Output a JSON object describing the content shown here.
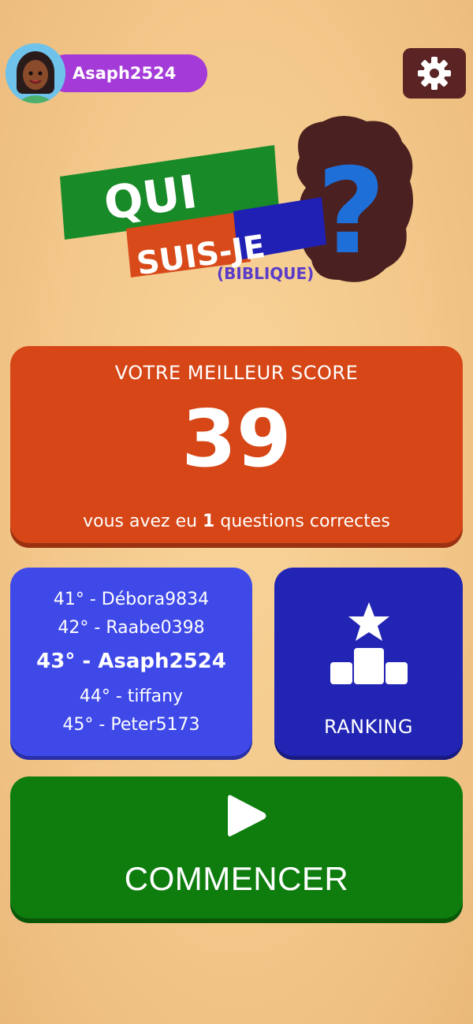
{
  "header": {
    "username": "Asaph2524",
    "settings_icon": "gear-icon",
    "avatar_icon": "avatar-icon"
  },
  "logo": {
    "line1": "QUI",
    "line2": "SUIS-JE",
    "line3": "(BIBLIQUE)",
    "mark": "?"
  },
  "score_card": {
    "label": "VOTRE MEILLEUR SCORE",
    "value": "39",
    "sub_prefix": "vous avez eu ",
    "sub_count": "1",
    "sub_suffix": " questions correctes"
  },
  "leaderboard": {
    "rows": [
      {
        "text": "41° - Débora9834"
      },
      {
        "text": "42° - Raabe0398"
      },
      {
        "text": "43° - Asaph2524",
        "current": true
      },
      {
        "text": "44° - tiffany"
      },
      {
        "text": "45° - Peter5173"
      }
    ]
  },
  "ranking": {
    "label": "RANKING",
    "icon": "podium-star-icon"
  },
  "start": {
    "label": "COMMENCER",
    "icon": "play-icon"
  },
  "colors": {
    "background": "#f3c88a",
    "score_card": "#d64616",
    "leaderboard": "#3f49e8",
    "ranking": "#2224b4",
    "start": "#0e7d0e",
    "user_pill": "#a43ad8",
    "settings": "#5a2424"
  }
}
